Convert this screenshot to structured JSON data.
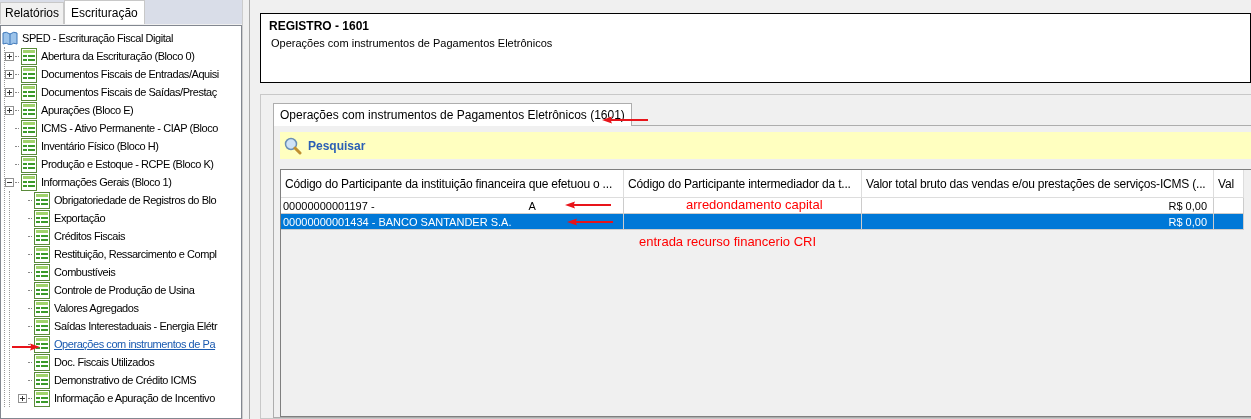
{
  "sidebar": {
    "tabs": [
      {
        "label": "Relatórios",
        "selected": false
      },
      {
        "label": "Escrituração",
        "selected": true
      }
    ],
    "tree": {
      "label": "SPED - Escrituração Fiscal Digital",
      "children": [
        {
          "label": "Abertura da Escrituração (Bloco 0)",
          "kind": "group",
          "expanded": false,
          "selected": false
        },
        {
          "label": "Documentos Fiscais de Entradas/Aquisi",
          "kind": "group",
          "expanded": false,
          "selected": false
        },
        {
          "label": "Documentos Fiscais de Saídas/Prestaç",
          "kind": "group",
          "expanded": false,
          "selected": false
        },
        {
          "label": "Apurações (Bloco E)",
          "kind": "group",
          "expanded": false,
          "selected": false
        },
        {
          "label": "ICMS - Ativo Permanente - CIAP (Bloco",
          "kind": "leaf",
          "selected": false
        },
        {
          "label": "Inventário Físico (Bloco H)",
          "kind": "leaf",
          "selected": false
        },
        {
          "label": "Produção e Estoque - RCPE (Bloco K)",
          "kind": "leaf",
          "selected": false
        },
        {
          "label": "Informações Gerais (Bloco 1)",
          "kind": "group",
          "expanded": true,
          "selected": false,
          "children": [
            {
              "label": "Obrigatoriedade de Registros do Blo",
              "kind": "leaf",
              "selected": false
            },
            {
              "label": "Exportação",
              "kind": "leaf",
              "selected": false
            },
            {
              "label": "Créditos Fiscais",
              "kind": "leaf",
              "selected": false
            },
            {
              "label": "Restituição, Ressarcimento e Compl",
              "kind": "leaf",
              "selected": false
            },
            {
              "label": "Combustíveis",
              "kind": "leaf",
              "selected": false
            },
            {
              "label": "Controle de Produção de Usina",
              "kind": "leaf",
              "selected": false
            },
            {
              "label": "Valores Agregados",
              "kind": "leaf",
              "selected": false
            },
            {
              "label": "Saídas Interestaduais - Energia Elétr",
              "kind": "leaf",
              "selected": false
            },
            {
              "label": "Operações com instrumentos de Pa",
              "kind": "leaf",
              "selected": true
            },
            {
              "label": "Doc. Fiscais Utilizados",
              "kind": "leaf",
              "selected": false
            },
            {
              "label": "Demonstrativo de Crédito ICMS",
              "kind": "leaf",
              "selected": false
            },
            {
              "label": "Informação e Apuração de Incentivo",
              "kind": "group",
              "expanded": false,
              "selected": false
            }
          ]
        }
      ]
    }
  },
  "header": {
    "title": "REGISTRO - 1601",
    "subtitle": "Operações com instrumentos de Pagamentos Eletrônicos"
  },
  "tabs": [
    {
      "label": "Operações com instrumentos de Pagamentos Eletrônicos (1601)",
      "selected": true
    }
  ],
  "search": {
    "label": "Pesquisar"
  },
  "table": {
    "columns": [
      "Código do Participante da instituição financeira que efetuou o ...",
      "Código do Participante intermediador da t...",
      "Valor total bruto das vendas e/ou prestações de serviços-ICMS (...",
      "Val"
    ],
    "rows": [
      {
        "cells": [
          "00000000001197 -",
          "",
          "R$ 0,00",
          ""
        ],
        "tail": "A",
        "redacted": true,
        "selected": false
      },
      {
        "cells": [
          "00000000001434 - BANCO SANTANDER S.A.",
          "",
          "R$ 0,00",
          ""
        ],
        "redacted": false,
        "selected": true
      }
    ]
  },
  "annotations": [
    "arredondamento capital",
    "entrada recurso financerio CRI"
  ]
}
